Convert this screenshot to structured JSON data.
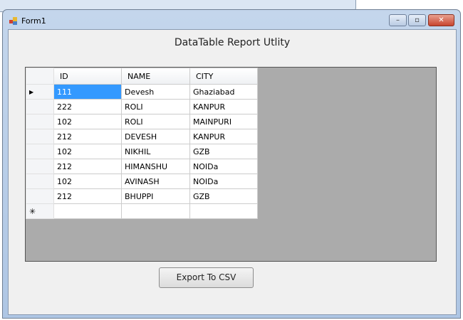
{
  "window": {
    "title": "Form1",
    "minimize": "–",
    "maximize": "▫",
    "close": "✕"
  },
  "heading": "DataTable Report Utlity",
  "table": {
    "columns": [
      "ID",
      "NAME",
      "CITY"
    ],
    "rows": [
      [
        "111",
        "Devesh",
        "Ghaziabad"
      ],
      [
        "222",
        "ROLI",
        "KANPUR"
      ],
      [
        "102",
        "ROLI",
        "MAINPURI"
      ],
      [
        "212",
        "DEVESH",
        "KANPUR"
      ],
      [
        "102",
        "NIKHIL",
        "GZB"
      ],
      [
        "212",
        "HIMANSHU",
        "NOIDa"
      ],
      [
        "102",
        "AVINASH",
        "NOIDa"
      ],
      [
        "212",
        "BHUPPI",
        "GZB"
      ]
    ],
    "current_row_marker": "▶",
    "new_row_marker": "✳"
  },
  "export_button": "Export To CSV"
}
